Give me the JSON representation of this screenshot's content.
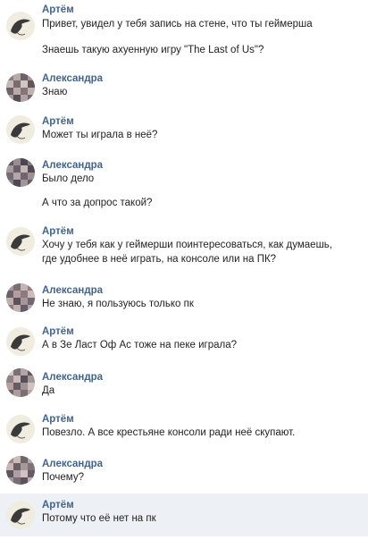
{
  "messages": [
    {
      "author": "Артём",
      "lines": [
        "Привет, увидел у тебя запись на стене, что ты геймерша",
        "Знаешь такую ахуенную игру \"The Last of Us\"?"
      ]
    },
    {
      "author": "Александра",
      "lines": [
        "Знаю"
      ]
    },
    {
      "author": "Артём",
      "lines": [
        "Может ты играла в неё?"
      ]
    },
    {
      "author": "Александра",
      "lines": [
        "Было дело",
        "А что за допрос такой?"
      ]
    },
    {
      "author": "Артём",
      "lines": [
        "Хочу у тебя как у геймерши поинтересоваться, как думаешь,",
        "где удобнее в неё играть, на консоле или на ПК?"
      ]
    },
    {
      "author": "Александра",
      "lines": [
        "Не знаю, я пользуюсь только пк"
      ]
    },
    {
      "author": "Артём",
      "lines": [
        "А в Зе Ласт Оф Ас тоже на пеке играла?"
      ]
    },
    {
      "author": "Александра",
      "lines": [
        "Да"
      ]
    },
    {
      "author": "Артём",
      "lines": [
        "Повезло. А все крестьяне консоли ради неё скупают."
      ]
    },
    {
      "author": "Александра",
      "lines": [
        "Почему?"
      ]
    },
    {
      "author": "Артём",
      "lines": [
        "Потому что её нет на пк"
      ]
    }
  ],
  "colors": {
    "author_name": "#42648b",
    "highlight_row": "#edf0f5"
  },
  "icons": {
    "artem_avatar": "sketch-avatar-icon",
    "alexandra_avatar": "pixelated-avatar-icon"
  }
}
